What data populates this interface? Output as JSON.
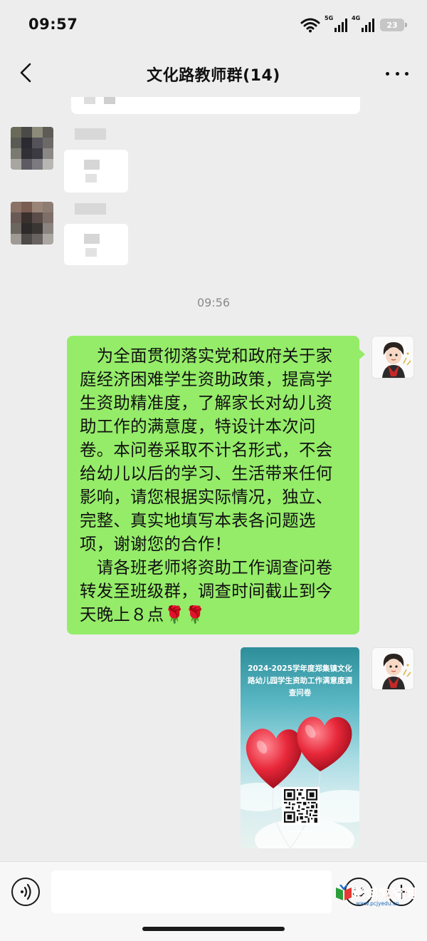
{
  "status_bar": {
    "time": "09:57",
    "network_1": "5G",
    "network_2": "4G",
    "battery_level": "23"
  },
  "header": {
    "title": "文化路教师群(14)"
  },
  "conversation": {
    "time_divider": "09:56",
    "my_text_message": "　为全面贯彻落实党和政府关于家庭经济困难学生资助政策，提高学生资助精准度，了解家长对幼儿资助工作的满意度，特设计本次问卷。本问卷采取不计名形式，不会给幼儿以后的学习、生活带来任何影响，请您根据实际情况，独立、完整、真实地填写本表各问题选项，谢谢您的合作！\n　请各班老师将资助工作调查问卷转发至班级群，调查时间截止到今天晚上８点🌹🌹",
    "poster": {
      "title": "2024-2025学年度郑集镇文化路幼儿园学生资助工作满意度调查问卷"
    }
  },
  "input_bar": {
    "placeholder": ""
  },
  "watermark": {
    "name": "彭城教育网",
    "url": "www.pcjyedu.cn"
  },
  "colors": {
    "background": "#ededed",
    "my_bubble": "#95ec69",
    "balloon": "#e8283a"
  }
}
